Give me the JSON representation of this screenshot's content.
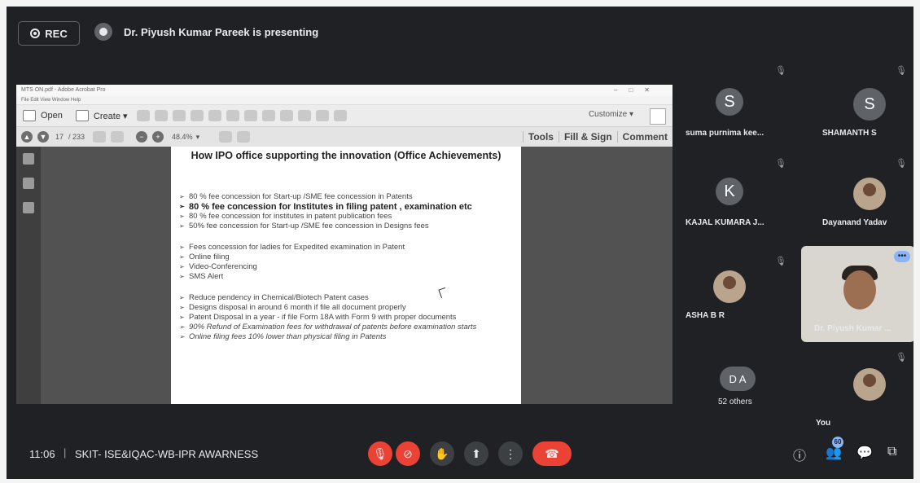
{
  "topbar": {
    "rec_label": "REC",
    "presenter_text": "Dr. Piyush Kumar Pareek is presenting"
  },
  "acrobat": {
    "title": "MTS ON.pdf - Adobe Acrobat Pro",
    "menu": "File  Edit  View  Window  Help",
    "open_label": "Open",
    "create_label": "Create ▾",
    "customize_label": "Customize ▾",
    "page_current": "17",
    "page_total": "/ 233",
    "zoom": "48.4%",
    "tools_label": "Tools",
    "fill_sign_label": "Fill & Sign",
    "comment_label": "Comment"
  },
  "slide": {
    "heading": "How IPO office  supporting the innovation (Office Achievements)",
    "group1": [
      {
        "text": "80 % fee concession for Start-up /SME fee concession in Patents",
        "style": "n"
      },
      {
        "text": "80 % fee concession for Institutes in filing patent , examination etc",
        "style": "b"
      },
      {
        "text": "80 % fee concession for institutes in patent publication fees",
        "style": "n"
      },
      {
        "text": "50% fee concession for Start-up /SME fee concession in Designs fees",
        "style": "n"
      }
    ],
    "group2": [
      {
        "text": "Fees concession for ladies for Expedited examination in Patent",
        "style": "n"
      },
      {
        "text": "Online filing",
        "style": "n"
      },
      {
        "text": "Video-Conferencing",
        "style": "n"
      },
      {
        "text": "SMS Alert",
        "style": "n"
      }
    ],
    "group3": [
      {
        "text": "Reduce pendency in Chemical/Biotech Patent cases",
        "style": "n"
      },
      {
        "text": "Designs disposal in around 6 month if file all document properly",
        "style": "n"
      },
      {
        "text": "Patent Disposal in a year - if file Form 18A with Form 9 with proper documents",
        "style": "n"
      },
      {
        "text": "90% Refund of Examination fees for withdrawal of  patents before examination starts",
        "style": "i"
      },
      {
        "text": "Online filing  fees 10% lower than physical filing in Patents",
        "style": "i"
      }
    ]
  },
  "participants": [
    {
      "initial": "S",
      "name": "suma purnima kee...",
      "color": "#5f6368"
    },
    {
      "initial": "S",
      "name": "SHAMANTH S",
      "color": "#5f6368"
    },
    {
      "initial": "K",
      "name": "KAJAL KUMARA J...",
      "color": "#5f6368"
    },
    {
      "initial": "",
      "name": "Dayanand Yadav",
      "color": "#3c4043"
    },
    {
      "initial": "",
      "name": "ASHA B R",
      "color": "#b9a58d"
    },
    {
      "initial": "",
      "name": "Dr. Piyush Kumar ...",
      "color": "#d9d6cf"
    },
    {
      "initial": "D  A",
      "name": "52 others",
      "color": "#5f6368"
    },
    {
      "initial": "",
      "name": "You",
      "color": "#b9a58d"
    }
  ],
  "bottom": {
    "time": "11:06",
    "separator": "|",
    "meeting_title": "SKIT- ISE&IQAC-WB-IPR AWARNESS",
    "people_count": "60"
  },
  "icons": {
    "mic_off": "🎙",
    "cam_off": "⊘",
    "hand": "✋",
    "present": "⬆",
    "more": "⋮",
    "end_call": "☎",
    "info": "ⓘ",
    "people": "👥",
    "chat": "💬",
    "activities": "⧉"
  }
}
